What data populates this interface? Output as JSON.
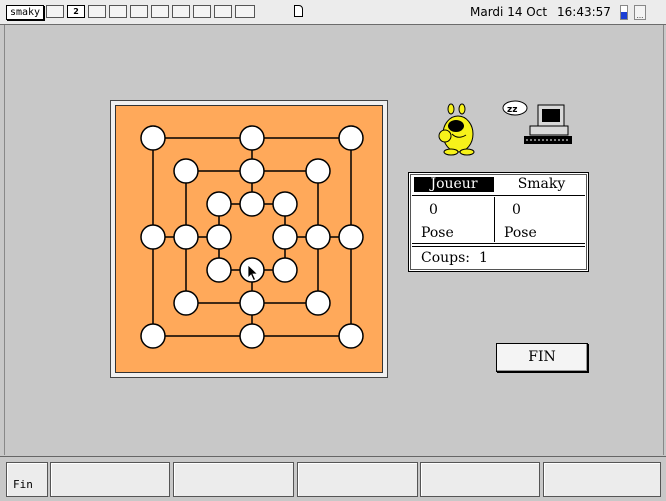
{
  "topbar": {
    "logo": "smaky",
    "slots": [
      "",
      "2",
      "",
      "",
      "",
      "",
      "",
      "",
      "",
      ""
    ],
    "date": "Mardi 14 Oct",
    "time": "16:43:57",
    "battery_level": 0.55
  },
  "game": {
    "board_color": "#ffa95a",
    "positions": [
      {
        "id": "a7",
        "col": 1,
        "row": 7
      },
      {
        "id": "d7",
        "col": 4,
        "row": 7
      },
      {
        "id": "g7",
        "col": 7,
        "row": 7
      },
      {
        "id": "b6",
        "col": 2,
        "row": 6
      },
      {
        "id": "d6",
        "col": 4,
        "row": 6
      },
      {
        "id": "f6",
        "col": 6,
        "row": 6
      },
      {
        "id": "c5",
        "col": 3,
        "row": 5
      },
      {
        "id": "d5",
        "col": 4,
        "row": 5
      },
      {
        "id": "e5",
        "col": 5,
        "row": 5
      },
      {
        "id": "a4",
        "col": 1,
        "row": 4
      },
      {
        "id": "b4",
        "col": 2,
        "row": 4
      },
      {
        "id": "c4",
        "col": 3,
        "row": 4
      },
      {
        "id": "e4",
        "col": 5,
        "row": 4
      },
      {
        "id": "f4",
        "col": 6,
        "row": 4
      },
      {
        "id": "g4",
        "col": 7,
        "row": 4
      },
      {
        "id": "c3",
        "col": 3,
        "row": 3
      },
      {
        "id": "d3",
        "col": 4,
        "row": 3
      },
      {
        "id": "e3",
        "col": 5,
        "row": 3
      },
      {
        "id": "b2",
        "col": 2,
        "row": 2
      },
      {
        "id": "d2",
        "col": 4,
        "row": 2
      },
      {
        "id": "f2",
        "col": 6,
        "row": 2
      },
      {
        "id": "a1",
        "col": 1,
        "row": 1
      },
      {
        "id": "d1",
        "col": 4,
        "row": 1
      },
      {
        "id": "g1",
        "col": 7,
        "row": 1
      }
    ]
  },
  "score": {
    "player_label": "Joueur",
    "computer_label": "Smaky",
    "player_score": "0",
    "computer_score": "0",
    "player_mode": "Pose",
    "computer_mode": "Pose",
    "coups_label": "Coups:",
    "coups_value": "1"
  },
  "buttons": {
    "fin": "FIN"
  },
  "function_keys": [
    "Fin",
    "",
    "",
    "",
    "",
    ""
  ]
}
